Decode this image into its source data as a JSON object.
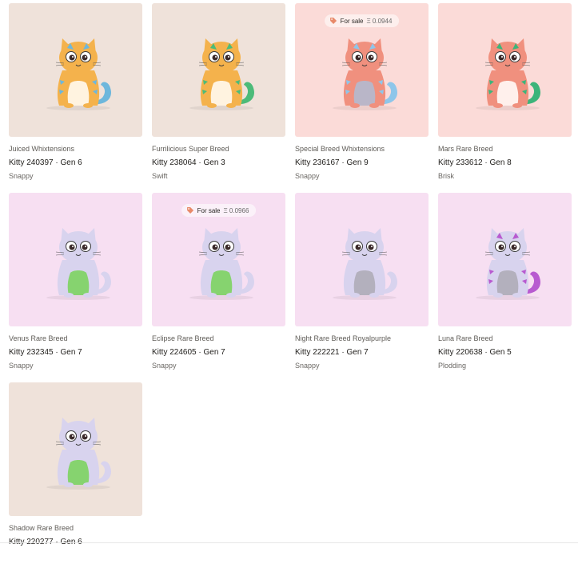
{
  "kitties": [
    {
      "cattribute": "Juiced Whixtensions",
      "title": "Kitty 240397 · Gen 6",
      "speed": "Snappy",
      "bg": "#efe2da",
      "body": "#f4b24c",
      "accent": "#6db7dc",
      "belly": "#fff3e0",
      "for_sale": false
    },
    {
      "cattribute": "Furrilicious Super Breed",
      "title": "Kitty 238064 · Gen 3",
      "speed": "Swift",
      "bg": "#efe2da",
      "body": "#f4b24c",
      "accent": "#4cbb79",
      "belly": "#fff3e0",
      "for_sale": false
    },
    {
      "cattribute": "Special Breed Whixtensions",
      "title": "Kitty 236167 · Gen 9",
      "speed": "Snappy",
      "bg": "#fbdbd8",
      "body": "#f0907e",
      "accent": "#8ec6ea",
      "belly": "#b9b6c8",
      "for_sale": true,
      "sale_label": "For sale",
      "sale_price": "Ξ 0.0944"
    },
    {
      "cattribute": "Mars Rare Breed",
      "title": "Kitty 233612 · Gen 8",
      "speed": "Brisk",
      "bg": "#fbdbd8",
      "body": "#f0907e",
      "accent": "#3cb47a",
      "belly": "#fff0ec",
      "for_sale": false
    },
    {
      "cattribute": "Venus Rare Breed",
      "title": "Kitty 232345 · Gen 7",
      "speed": "Snappy",
      "bg": "#f7dff2",
      "body": "#d8d3ee",
      "accent": "#d8d3ee",
      "belly": "#86d36f",
      "for_sale": false
    },
    {
      "cattribute": "Eclipse Rare Breed",
      "title": "Kitty 224605 · Gen 7",
      "speed": "Snappy",
      "bg": "#f7dff2",
      "body": "#d8d3ee",
      "accent": "#d8d3ee",
      "belly": "#86d36f",
      "for_sale": true,
      "sale_label": "For sale",
      "sale_price": "Ξ 0.0966"
    },
    {
      "cattribute": "Night Rare Breed Royalpurple",
      "title": "Kitty 222221 · Gen 7",
      "speed": "Snappy",
      "bg": "#f7dff2",
      "body": "#d8d3ee",
      "accent": "#d8d3ee",
      "belly": "#b3b0bd",
      "for_sale": false
    },
    {
      "cattribute": "Luna Rare Breed",
      "title": "Kitty 220638 · Gen 5",
      "speed": "Plodding",
      "bg": "#f7dff2",
      "body": "#d8d3ee",
      "accent": "#b85ad0",
      "belly": "#b3b0bd",
      "for_sale": false
    },
    {
      "cattribute": "Shadow Rare Breed",
      "title": "Kitty 220277 · Gen 6",
      "speed": "",
      "bg": "#efe2da",
      "body": "#d8d3ee",
      "accent": "#d8d3ee",
      "belly": "#86d36f",
      "for_sale": false
    }
  ]
}
